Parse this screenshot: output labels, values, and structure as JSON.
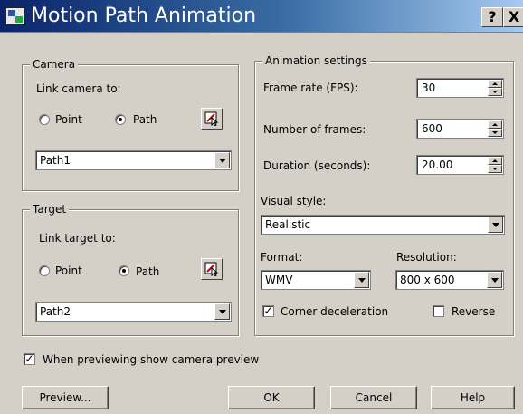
{
  "window": {
    "title": "Motion Path Animation",
    "help": "?",
    "close": "X"
  },
  "camera": {
    "legend": "Camera",
    "link_label": "Link camera to:",
    "radio_point": "Point",
    "radio_path": "Path",
    "selected": "Path",
    "path_value": "Path1"
  },
  "target": {
    "legend": "Target",
    "link_label": "Link target to:",
    "radio_point": "Point",
    "radio_path": "Path",
    "selected": "Path",
    "path_value": "Path2"
  },
  "animation": {
    "legend": "Animation settings",
    "frame_rate_label": "Frame rate (FPS):",
    "frame_rate": "30",
    "frames_label": "Number of frames:",
    "frames": "600",
    "duration_label": "Duration (seconds):",
    "duration": "20.00",
    "visual_style_label": "Visual style:",
    "visual_style": "Realistic",
    "format_label": "Format:",
    "format": "WMV",
    "resolution_label": "Resolution:",
    "resolution": "800 x 600",
    "corner_label": "Corner deceleration",
    "corner_checked": true,
    "reverse_label": "Reverse",
    "reverse_checked": false
  },
  "preview_camera_label": "When previewing show camera preview",
  "preview_camera_checked": true,
  "buttons": {
    "preview": "Preview...",
    "ok": "OK",
    "cancel": "Cancel",
    "help": "Help"
  }
}
